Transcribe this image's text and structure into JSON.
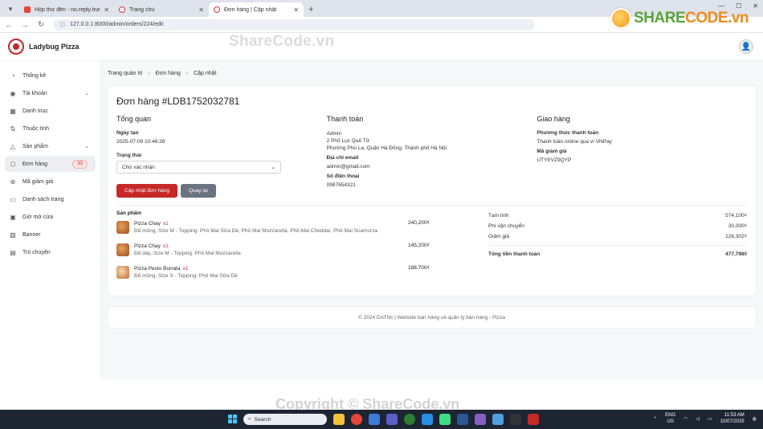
{
  "browser": {
    "tabs": [
      {
        "label": "Hộp thư đến - no.reply.hungdc",
        "icon": "gmail-icon"
      },
      {
        "label": "Trang chủ",
        "icon": "pizza-icon"
      },
      {
        "label": "Đơn hàng | Cập nhật",
        "icon": "pizza-icon",
        "active": true
      }
    ],
    "url": "127.0.0.1:8000/admin/orders/224/edit"
  },
  "watermarks": {
    "top": "ShareCode.vn",
    "bottom": "Copyright © ShareCode.vn",
    "logo_share": "SHARE",
    "logo_code": "CODE.vn"
  },
  "header": {
    "brand": "Ladybug Pizza"
  },
  "sidebar": {
    "items": [
      {
        "label": "Thống kê",
        "icon": "chart-pie-icon"
      },
      {
        "label": "Tài khoản",
        "icon": "user-circle-icon",
        "chevron": true
      },
      {
        "label": "Danh mục",
        "icon": "grid-icon"
      },
      {
        "label": "Thuộc tính",
        "icon": "sort-icon"
      },
      {
        "label": "Sản phẩm",
        "icon": "triangle-icon",
        "chevron": true
      },
      {
        "label": "Đơn hàng",
        "icon": "box-icon",
        "badge": "33",
        "active": true
      },
      {
        "label": "Mã giảm giá",
        "icon": "percent-icon"
      },
      {
        "label": "Danh sách trang",
        "icon": "file-icon"
      },
      {
        "label": "Giờ mở cửa",
        "icon": "calendar-icon"
      },
      {
        "label": "Banner",
        "icon": "image-icon"
      },
      {
        "label": "Trò chuyện",
        "icon": "chat-icon"
      }
    ]
  },
  "breadcrumb": [
    "Trang quản trị",
    "Đơn hàng",
    "Cập nhật"
  ],
  "order": {
    "title": "Đơn hàng #LDB1752032781",
    "overview": {
      "heading": "Tổng quan",
      "created_label": "Ngày tạo",
      "created_value": "2025-07-09 10:46:39",
      "status_label": "Trạng thái",
      "status_value": "Chờ xác nhận",
      "update_button": "Cập nhật đơn hàng",
      "back_button": "Quay lại"
    },
    "payment": {
      "heading": "Thanh toán",
      "name": "Admin",
      "address1": "2 Phố Lục Quế Tử",
      "address2": "Phường Phú La, Quận Hà Đông, Thành phố Hà Nội",
      "email_label": "Địa chỉ email",
      "email": "admin@gmail.com",
      "phone_label": "Số điện thoại",
      "phone": "0987654321"
    },
    "delivery": {
      "heading": "Giao hàng",
      "method_label": "Phương thức thanh toán",
      "method": "Thanh toán online qua ví VNPay",
      "coupon_label": "Mã giảm giá",
      "coupon": "UTYEVZ9QYP"
    },
    "products_heading": "Sản phẩm",
    "products": [
      {
        "name": "Pizza Chay",
        "qty": "x1",
        "desc": "Đế mỏng, Size M - Topping: Phô Mai Sữa Dê, Phô Mai Mozzarella, Phô Mai Cheddar, Phô Mai Scamorza",
        "price": "240,200₫"
      },
      {
        "name": "Pizza Chay",
        "qty": "x1",
        "desc": "Đế dày, Size M - Topping: Phô Mai Mozzarella",
        "price": "145,200₫"
      },
      {
        "name": "Pizza Pesto Burrata",
        "qty": "x1",
        "desc": "Đế mỏng, Size S - Topping: Phô Mai Sữa Dê",
        "price": "188,700₫"
      }
    ],
    "totals": [
      {
        "label": "Tạm tính",
        "value": "574,100₫"
      },
      {
        "label": "Phí vận chuyển",
        "value": "30,000₫"
      },
      {
        "label": "Giảm giá",
        "value": "126,302₫"
      }
    ],
    "grand_total": {
      "label": "Tổng tiền thanh toán",
      "value": "477,798₫"
    }
  },
  "footer": "© 2024 DATNc | Website bán hàng và quản lý bán hàng - Pizza",
  "taskbar": {
    "search": "Search",
    "lang1": "ENG",
    "lang2": "US",
    "time": "11:53 AM",
    "date": "10/07/2025"
  }
}
